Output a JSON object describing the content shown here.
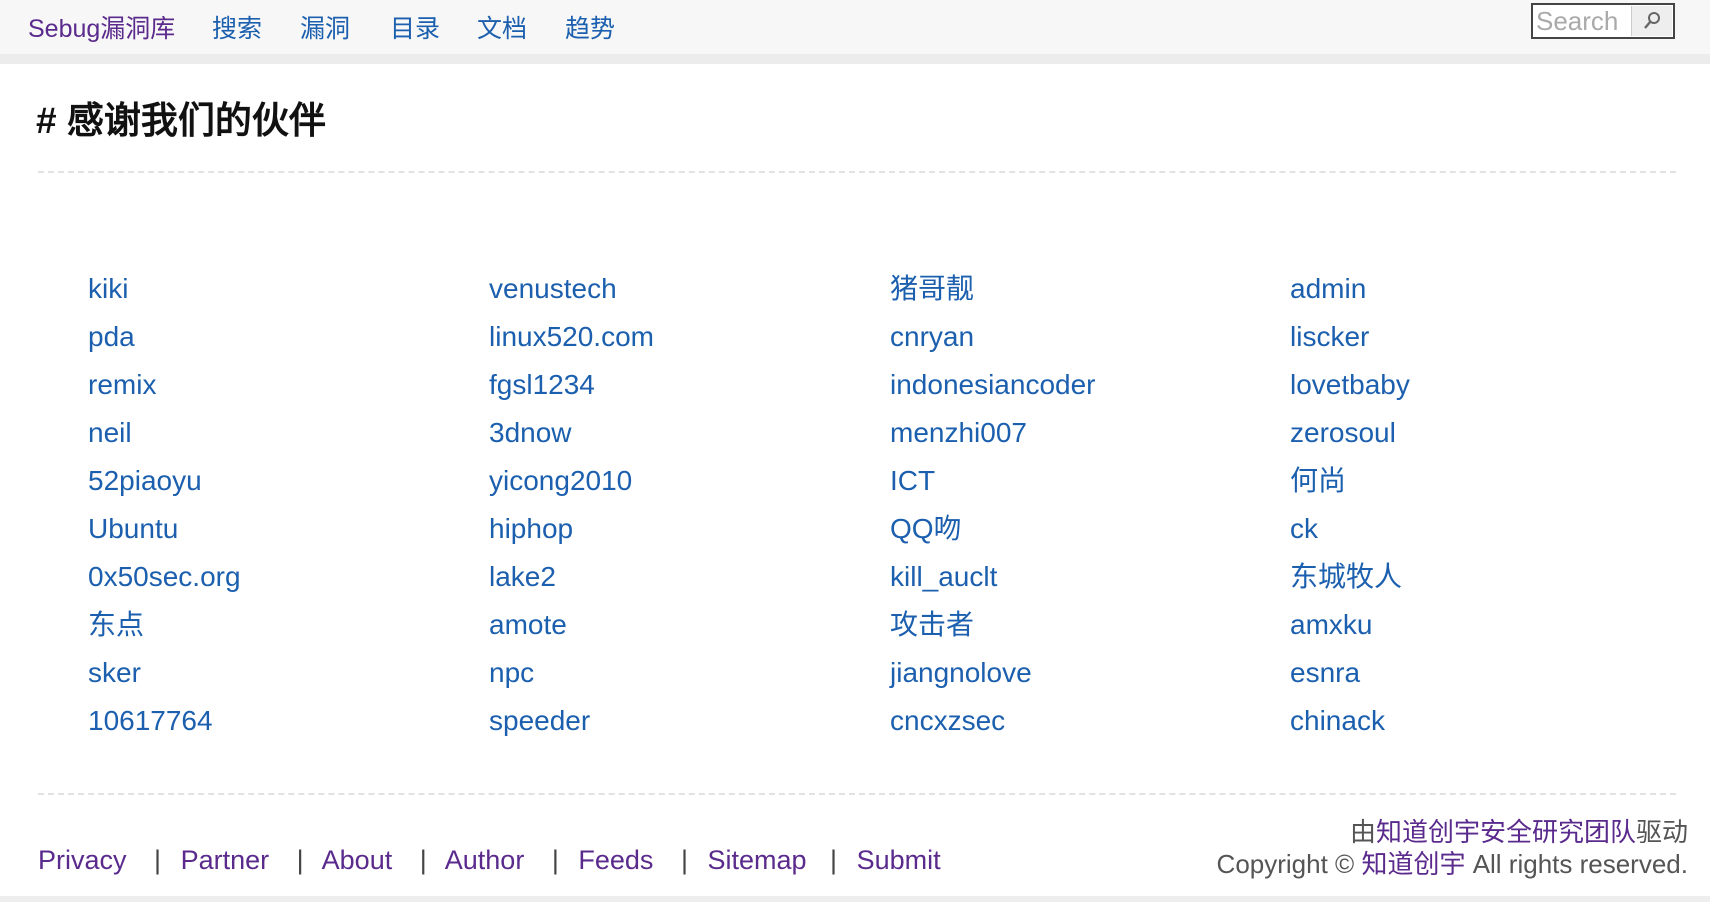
{
  "nav": {
    "brand": "Sebug漏洞库",
    "items": [
      {
        "label": "搜索"
      },
      {
        "label": "漏洞"
      },
      {
        "label": "目录"
      },
      {
        "label": "文档"
      },
      {
        "label": "趋势"
      }
    ],
    "search_placeholder": "Search"
  },
  "page": {
    "title": "# 感谢我们的伙伴"
  },
  "partners": {
    "columns": [
      [
        "kiki",
        "pda",
        "remix",
        "neil",
        "52piaoyu",
        "Ubuntu",
        "0x50sec.org",
        "东点",
        "sker",
        "10617764"
      ],
      [
        "venustech",
        "linux520.com",
        "fgsl1234",
        "3dnow",
        "yicong2010",
        "hiphop",
        "lake2",
        "amote",
        "npc",
        "speeder"
      ],
      [
        "猪哥靓",
        "cnryan",
        "indonesiancoder",
        "menzhi007",
        "ICT",
        "QQ吻",
        "kill_auclt",
        "攻击者",
        "jiangnolove",
        "cncxzsec"
      ],
      [
        "admin",
        "liscker",
        "lovetbaby",
        "zerosoul",
        "何尚",
        "ck",
        "东城牧人",
        "amxku",
        "esnra",
        "chinack"
      ]
    ]
  },
  "footer": {
    "links": [
      {
        "label": "Privacy"
      },
      {
        "label": "Partner"
      },
      {
        "label": "About"
      },
      {
        "label": "Author"
      },
      {
        "label": "Feeds"
      },
      {
        "label": "Sitemap"
      },
      {
        "label": "Submit"
      }
    ],
    "separator": "|",
    "powered_prefix": "由",
    "powered_link": "知道创宇安全研究团队",
    "powered_suffix": "驱动",
    "copyright_prefix": "Copyright ©",
    "copyright_link": "知道创宇",
    "copyright_suffix": "All rights reserved."
  }
}
